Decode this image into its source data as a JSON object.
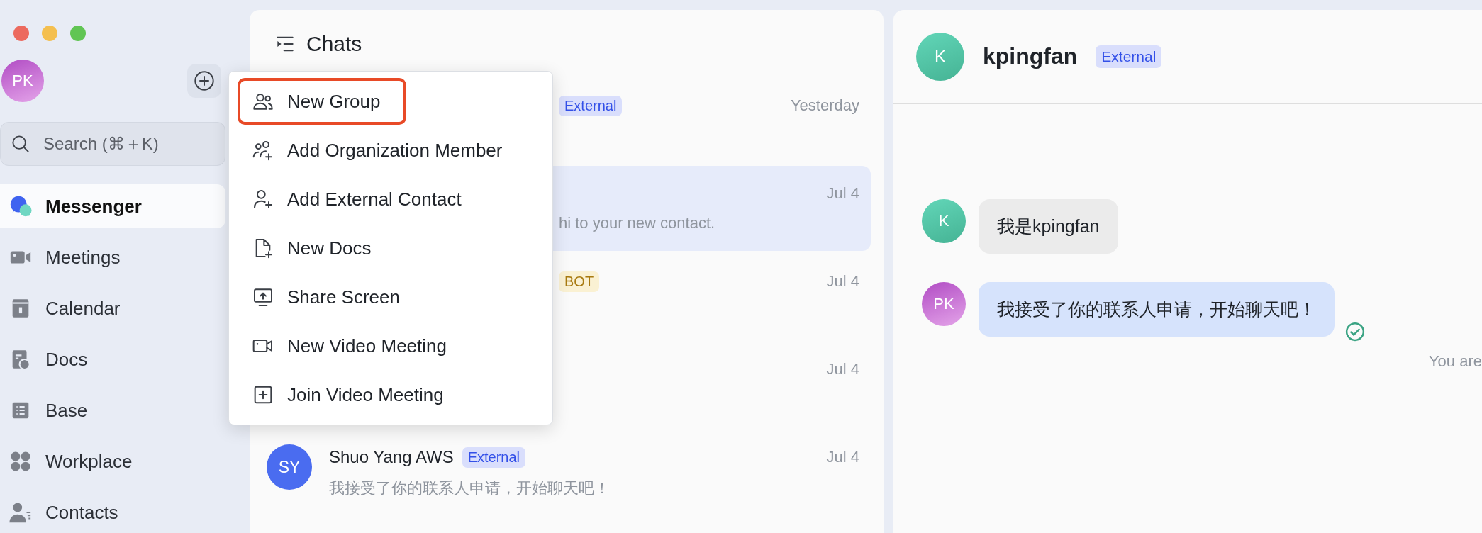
{
  "sidebar": {
    "avatar": "PK",
    "search": {
      "placeholder": "Search (⌘＋K)"
    },
    "nav": [
      {
        "label": "Messenger",
        "selected": true
      },
      {
        "label": "Meetings",
        "selected": false
      },
      {
        "label": "Calendar",
        "selected": false
      },
      {
        "label": "Docs",
        "selected": false
      },
      {
        "label": "Base",
        "selected": false
      },
      {
        "label": "Workplace",
        "selected": false
      },
      {
        "label": "Contacts",
        "selected": false
      }
    ]
  },
  "chat_list": {
    "title": "Chats",
    "chats": [
      {
        "tag": {
          "kind": "external",
          "text": "External"
        },
        "time": "Yesterday",
        "selected": false
      },
      {
        "time": "Jul 4",
        "preview": "hi to your new contact.",
        "selected": true
      },
      {
        "tag": {
          "kind": "bot",
          "text": "BOT"
        },
        "time": "Jul 4",
        "selected": false
      },
      {
        "time": "Jul 4",
        "selected": false
      },
      {
        "avatar": "SY",
        "name": "Shuo Yang AWS",
        "tag": {
          "kind": "external",
          "text": "External"
        },
        "time": "Jul 4",
        "preview": "我接受了你的联系人申请，开始聊天吧！",
        "selected": false
      }
    ]
  },
  "new_menu": {
    "items": [
      {
        "label": "New Group",
        "highlighted": true
      },
      {
        "label": "Add Organization Member",
        "highlighted": false
      },
      {
        "label": "Add External Contact",
        "highlighted": false
      },
      {
        "label": "New Docs",
        "highlighted": false
      },
      {
        "label": "Share Screen",
        "highlighted": false
      },
      {
        "label": "New Video Meeting",
        "highlighted": false
      },
      {
        "label": "Join Video Meeting",
        "highlighted": false
      }
    ]
  },
  "conversation": {
    "avatar": "K",
    "name": "kpingfan",
    "tag": {
      "kind": "external",
      "text": "External"
    },
    "messages": [
      {
        "kind": "incoming",
        "avatar": "K",
        "text": "我是kpingfan"
      },
      {
        "kind": "outgoing",
        "avatar": "PK",
        "text": "我接受了你的联系人申请，开始聊天吧！",
        "read": true
      }
    ],
    "notice": "You are"
  }
}
